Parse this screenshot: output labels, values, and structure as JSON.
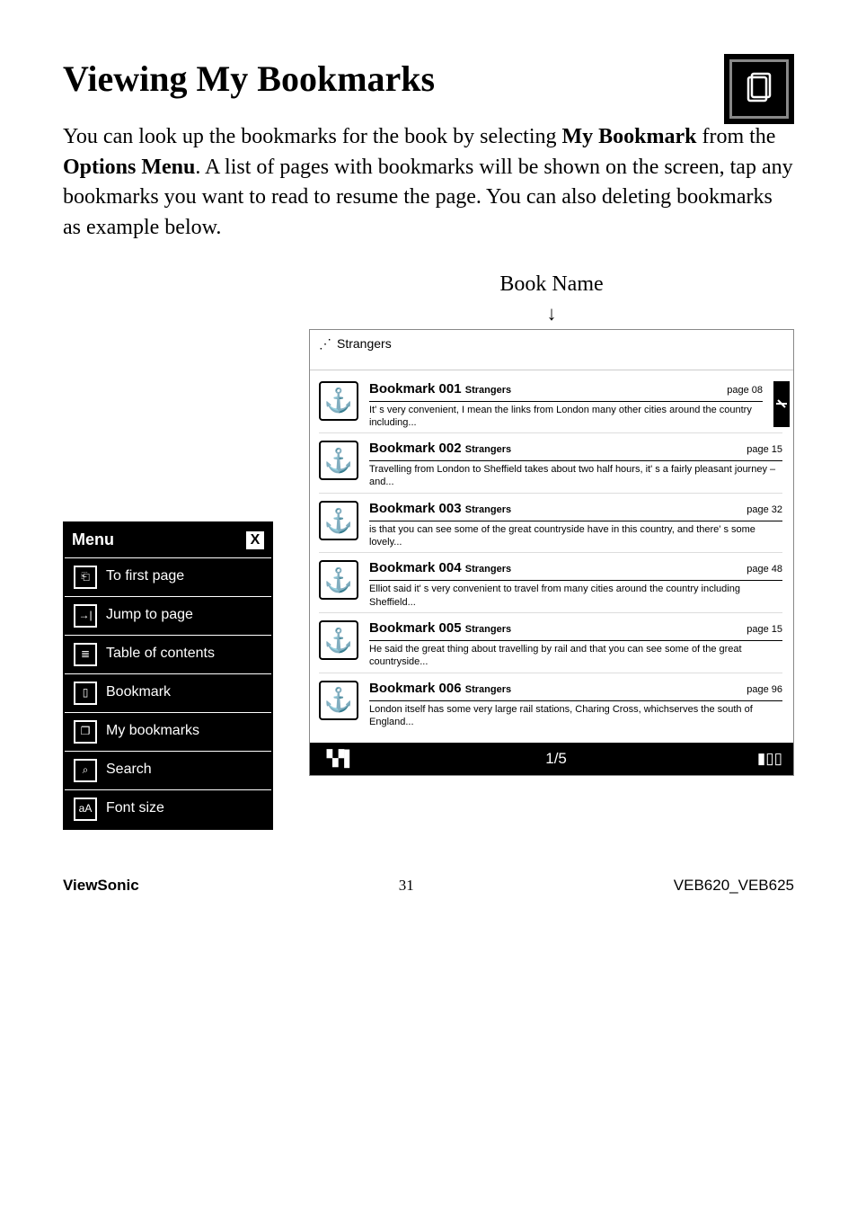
{
  "page": {
    "title": "Viewing My Bookmarks",
    "intro_part1": "You can look up the bookmarks for the book by selecting ",
    "intro_bold1": "My Bookmark",
    "intro_part2": " from the ",
    "intro_bold2": "Options Menu",
    "intro_part3": ". A list of pages with bookmarks will be shown on the screen, tap any bookmarks you want to read to resume the page. You can also deleting bookmarks as example below."
  },
  "menu": {
    "header": "Menu",
    "close": "X",
    "items": [
      {
        "label": "To first page"
      },
      {
        "label": "Jump to page"
      },
      {
        "label": "Table of contents"
      },
      {
        "label": "Bookmark"
      },
      {
        "label": "My bookmarks"
      },
      {
        "label": "Search"
      },
      {
        "label": "Font size"
      }
    ]
  },
  "device": {
    "book_name_label": "Book Name",
    "book_title": "Strangers",
    "bookmarks": [
      {
        "title": "Bookmark 001",
        "sub": "Strangers",
        "page": "page 08",
        "snippet": "It' s very convenient, I mean the links from London many other cities around the country including...",
        "deletable": true
      },
      {
        "title": "Bookmark 002",
        "sub": "Strangers",
        "page": "page 15",
        "snippet": "Travelling from London to Sheffield takes about two half hours, it' s a fairly pleasant journey – and...",
        "deletable": false
      },
      {
        "title": "Bookmark 003",
        "sub": "Strangers",
        "page": "page 32",
        "snippet": "is that you can see some of the great countryside have in this country, and there' s some lovely...",
        "deletable": false
      },
      {
        "title": "Bookmark 004",
        "sub": "Strangers",
        "page": "page 48",
        "snippet": "Elliot said it' s very convenient to travel from many cities around the country including Sheffield...",
        "deletable": false
      },
      {
        "title": "Bookmark 005",
        "sub": "Strangers",
        "page": "page 15",
        "snippet": "He said the great thing about travelling by rail and that you can see some of the great countryside...",
        "deletable": false
      },
      {
        "title": "Bookmark 006",
        "sub": "Strangers",
        "page": "page 96",
        "snippet": "London itself has some very large rail stations, Charing Cross, whichserves the south of England...",
        "deletable": false
      }
    ],
    "footer_page": "1/5"
  },
  "footer": {
    "brand": "ViewSonic",
    "page_num": "31",
    "model": "VEB620_VEB625"
  },
  "icons": {
    "anchor": "⚓",
    "signal": "▝▞▌",
    "battery": "▮▯▯"
  }
}
